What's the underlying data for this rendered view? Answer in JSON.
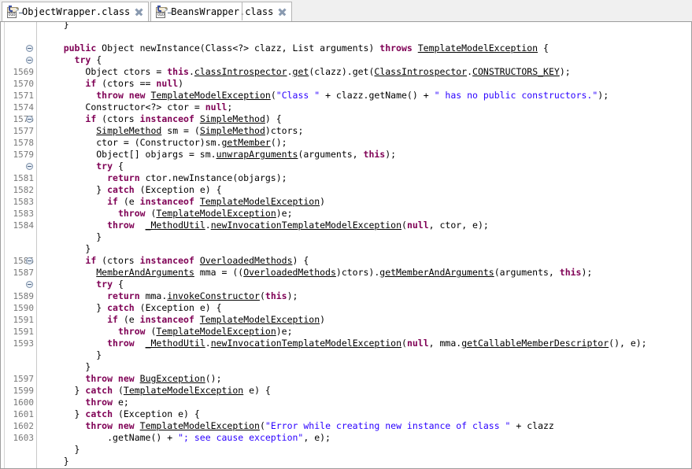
{
  "window": {
    "app": "eclipse-class-file-editor"
  },
  "tabs": [
    {
      "label": "ObjectWrapper.class",
      "icon": "class-file-icon",
      "close_icon": "close-icon",
      "active": false
    },
    {
      "label": "BeansWrapper.class",
      "icon": "class-file-icon",
      "close_icon": "close-icon",
      "active": true
    }
  ],
  "icons": {
    "class_file_bits": "010"
  },
  "colors": {
    "keyword": "#7F0055",
    "string": "#2A00FF",
    "text": "#000000",
    "line_number": "#787878",
    "gutter_border": "#C8C8C8",
    "tab_border": "#B4B4B4",
    "tab_bar_bg": "#F0F0F0"
  },
  "editor": {
    "lines": [
      {
        "num": "",
        "fold": false,
        "indent": 2,
        "tokens": [
          {
            "t": "}",
            "c": "plain"
          }
        ]
      },
      {
        "num": "",
        "fold": false,
        "indent": 0,
        "tokens": []
      },
      {
        "num": "",
        "fold": true,
        "indent": 2,
        "tokens": [
          {
            "t": "public ",
            "c": "kw"
          },
          {
            "t": "Object newInstance(Class<?> clazz, List arguments) ",
            "c": "plain"
          },
          {
            "t": "throws ",
            "c": "kw"
          },
          {
            "t": "TemplateModelException",
            "c": "plain ul"
          },
          {
            "t": " {",
            "c": "plain"
          }
        ]
      },
      {
        "num": "",
        "fold": true,
        "indent": 3,
        "tokens": [
          {
            "t": "try ",
            "c": "kw"
          },
          {
            "t": "{",
            "c": "plain"
          }
        ]
      },
      {
        "num": "1569",
        "fold": false,
        "indent": 4,
        "tokens": [
          {
            "t": "Object ctors = ",
            "c": "plain"
          },
          {
            "t": "this",
            "c": "kw"
          },
          {
            "t": ".",
            "c": "plain"
          },
          {
            "t": "classIntrospector",
            "c": "plain ul"
          },
          {
            "t": ".",
            "c": "plain"
          },
          {
            "t": "get",
            "c": "plain ul"
          },
          {
            "t": "(clazz).get(",
            "c": "plain"
          },
          {
            "t": "ClassIntrospector",
            "c": "plain ul"
          },
          {
            "t": ".",
            "c": "plain"
          },
          {
            "t": "CONSTRUCTORS_KEY",
            "c": "plain ul"
          },
          {
            "t": ");",
            "c": "plain"
          }
        ]
      },
      {
        "num": "1570",
        "fold": false,
        "indent": 4,
        "tokens": [
          {
            "t": "if ",
            "c": "kw"
          },
          {
            "t": "(ctors == ",
            "c": "plain"
          },
          {
            "t": "null",
            "c": "kw"
          },
          {
            "t": ")",
            "c": "plain"
          }
        ]
      },
      {
        "num": "1571",
        "fold": false,
        "indent": 5,
        "tokens": [
          {
            "t": "throw new ",
            "c": "kw"
          },
          {
            "t": "TemplateModelException",
            "c": "plain ul"
          },
          {
            "t": "(",
            "c": "plain"
          },
          {
            "t": "\"Class \"",
            "c": "str"
          },
          {
            "t": " + clazz.getName() + ",
            "c": "plain"
          },
          {
            "t": "\" has no public constructors.\"",
            "c": "str"
          },
          {
            "t": ");",
            "c": "plain"
          }
        ]
      },
      {
        "num": "1574",
        "fold": false,
        "indent": 4,
        "tokens": [
          {
            "t": "Constructor<?> ctor = ",
            "c": "plain"
          },
          {
            "t": "null",
            "c": "kw"
          },
          {
            "t": ";",
            "c": "plain"
          }
        ]
      },
      {
        "num": "1576",
        "fold": true,
        "indent": 4,
        "tokens": [
          {
            "t": "if ",
            "c": "kw"
          },
          {
            "t": "(ctors ",
            "c": "plain"
          },
          {
            "t": "instanceof ",
            "c": "kw"
          },
          {
            "t": "SimpleMethod",
            "c": "plain ul"
          },
          {
            "t": ") {",
            "c": "plain"
          }
        ]
      },
      {
        "num": "1577",
        "fold": false,
        "indent": 5,
        "tokens": [
          {
            "t": "SimpleMethod",
            "c": "plain ul"
          },
          {
            "t": " sm = (",
            "c": "plain"
          },
          {
            "t": "SimpleMethod",
            "c": "plain ul"
          },
          {
            "t": ")ctors;",
            "c": "plain"
          }
        ]
      },
      {
        "num": "1578",
        "fold": false,
        "indent": 5,
        "tokens": [
          {
            "t": "ctor = (Constructor)sm.",
            "c": "plain"
          },
          {
            "t": "getMember",
            "c": "plain ul"
          },
          {
            "t": "();",
            "c": "plain"
          }
        ]
      },
      {
        "num": "1579",
        "fold": false,
        "indent": 5,
        "tokens": [
          {
            "t": "Object[] objargs = sm.",
            "c": "plain"
          },
          {
            "t": "unwrapArguments",
            "c": "plain ul"
          },
          {
            "t": "(arguments, ",
            "c": "plain"
          },
          {
            "t": "this",
            "c": "kw"
          },
          {
            "t": ");",
            "c": "plain"
          }
        ]
      },
      {
        "num": "",
        "fold": true,
        "indent": 5,
        "tokens": [
          {
            "t": "try ",
            "c": "kw"
          },
          {
            "t": "{",
            "c": "plain"
          }
        ]
      },
      {
        "num": "1581",
        "fold": false,
        "indent": 6,
        "tokens": [
          {
            "t": "return ",
            "c": "kw"
          },
          {
            "t": "ctor.newInstance(objargs);",
            "c": "plain"
          }
        ]
      },
      {
        "num": "1582",
        "fold": false,
        "indent": 5,
        "tokens": [
          {
            "t": "} ",
            "c": "plain"
          },
          {
            "t": "catch ",
            "c": "kw"
          },
          {
            "t": "(Exception e) {",
            "c": "plain"
          }
        ]
      },
      {
        "num": "1583",
        "fold": false,
        "indent": 6,
        "tokens": [
          {
            "t": "if ",
            "c": "kw"
          },
          {
            "t": "(e ",
            "c": "plain"
          },
          {
            "t": "instanceof ",
            "c": "kw"
          },
          {
            "t": "TemplateModelException",
            "c": "plain ul"
          },
          {
            "t": ")",
            "c": "plain"
          }
        ]
      },
      {
        "num": "1583",
        "fold": false,
        "indent": 7,
        "tokens": [
          {
            "t": "throw ",
            "c": "kw"
          },
          {
            "t": "(",
            "c": "plain"
          },
          {
            "t": "TemplateModelException",
            "c": "plain ul"
          },
          {
            "t": ")e;",
            "c": "plain"
          }
        ]
      },
      {
        "num": "1584",
        "fold": false,
        "indent": 6,
        "tokens": [
          {
            "t": "throw ",
            "c": "kw"
          },
          {
            "t": " ",
            "c": "plain"
          },
          {
            "t": "_MethodUtil",
            "c": "plain ul"
          },
          {
            "t": ".",
            "c": "plain"
          },
          {
            "t": "newInvocationTemplateModelException",
            "c": "plain ul"
          },
          {
            "t": "(",
            "c": "plain"
          },
          {
            "t": "null",
            "c": "kw"
          },
          {
            "t": ", ctor, e);",
            "c": "plain"
          }
        ]
      },
      {
        "num": "",
        "fold": false,
        "indent": 5,
        "tokens": [
          {
            "t": "}",
            "c": "plain"
          }
        ]
      },
      {
        "num": "",
        "fold": false,
        "indent": 4,
        "tokens": [
          {
            "t": "}",
            "c": "plain"
          }
        ]
      },
      {
        "num": "1586",
        "fold": true,
        "indent": 4,
        "tokens": [
          {
            "t": "if ",
            "c": "kw"
          },
          {
            "t": "(ctors ",
            "c": "plain"
          },
          {
            "t": "instanceof ",
            "c": "kw"
          },
          {
            "t": "OverloadedMethods",
            "c": "plain ul"
          },
          {
            "t": ") {",
            "c": "plain"
          }
        ]
      },
      {
        "num": "1587",
        "fold": false,
        "indent": 5,
        "tokens": [
          {
            "t": "MemberAndArguments",
            "c": "plain ul"
          },
          {
            "t": " mma = ((",
            "c": "plain"
          },
          {
            "t": "OverloadedMethods",
            "c": "plain ul"
          },
          {
            "t": ")ctors).",
            "c": "plain"
          },
          {
            "t": "getMemberAndArguments",
            "c": "plain ul"
          },
          {
            "t": "(arguments, ",
            "c": "plain"
          },
          {
            "t": "this",
            "c": "kw"
          },
          {
            "t": ");",
            "c": "plain"
          }
        ]
      },
      {
        "num": "",
        "fold": true,
        "indent": 5,
        "tokens": [
          {
            "t": "try ",
            "c": "kw"
          },
          {
            "t": "{",
            "c": "plain"
          }
        ]
      },
      {
        "num": "1589",
        "fold": false,
        "indent": 6,
        "tokens": [
          {
            "t": "return ",
            "c": "kw"
          },
          {
            "t": "mma.",
            "c": "plain"
          },
          {
            "t": "invokeConstructor",
            "c": "plain ul"
          },
          {
            "t": "(",
            "c": "plain"
          },
          {
            "t": "this",
            "c": "kw"
          },
          {
            "t": ");",
            "c": "plain"
          }
        ]
      },
      {
        "num": "1590",
        "fold": false,
        "indent": 5,
        "tokens": [
          {
            "t": "} ",
            "c": "plain"
          },
          {
            "t": "catch ",
            "c": "kw"
          },
          {
            "t": "(Exception e) {",
            "c": "plain"
          }
        ]
      },
      {
        "num": "1591",
        "fold": false,
        "indent": 6,
        "tokens": [
          {
            "t": "if ",
            "c": "kw"
          },
          {
            "t": "(e ",
            "c": "plain"
          },
          {
            "t": "instanceof ",
            "c": "kw"
          },
          {
            "t": "TemplateModelException",
            "c": "plain ul"
          },
          {
            "t": ")",
            "c": "plain"
          }
        ]
      },
      {
        "num": "1591",
        "fold": false,
        "indent": 7,
        "tokens": [
          {
            "t": "throw ",
            "c": "kw"
          },
          {
            "t": "(",
            "c": "plain"
          },
          {
            "t": "TemplateModelException",
            "c": "plain ul"
          },
          {
            "t": ")e;",
            "c": "plain"
          }
        ]
      },
      {
        "num": "1593",
        "fold": false,
        "indent": 6,
        "tokens": [
          {
            "t": "throw ",
            "c": "kw"
          },
          {
            "t": " ",
            "c": "plain"
          },
          {
            "t": "_MethodUtil",
            "c": "plain ul"
          },
          {
            "t": ".",
            "c": "plain"
          },
          {
            "t": "newInvocationTemplateModelException",
            "c": "plain ul"
          },
          {
            "t": "(",
            "c": "plain"
          },
          {
            "t": "null",
            "c": "kw"
          },
          {
            "t": ", mma.",
            "c": "plain"
          },
          {
            "t": "getCallableMemberDescriptor",
            "c": "plain ul"
          },
          {
            "t": "(), e);",
            "c": "plain"
          }
        ]
      },
      {
        "num": "",
        "fold": false,
        "indent": 5,
        "tokens": [
          {
            "t": "}",
            "c": "plain"
          }
        ]
      },
      {
        "num": "",
        "fold": false,
        "indent": 4,
        "tokens": [
          {
            "t": "}",
            "c": "plain"
          }
        ]
      },
      {
        "num": "1597",
        "fold": false,
        "indent": 4,
        "tokens": [
          {
            "t": "throw new ",
            "c": "kw"
          },
          {
            "t": "BugException",
            "c": "plain ul"
          },
          {
            "t": "();",
            "c": "plain"
          }
        ]
      },
      {
        "num": "1599",
        "fold": false,
        "indent": 3,
        "tokens": [
          {
            "t": "} ",
            "c": "plain"
          },
          {
            "t": "catch ",
            "c": "kw"
          },
          {
            "t": "(",
            "c": "plain"
          },
          {
            "t": "TemplateModelException",
            "c": "plain ul"
          },
          {
            "t": " e) {",
            "c": "plain"
          }
        ]
      },
      {
        "num": "1600",
        "fold": false,
        "indent": 4,
        "tokens": [
          {
            "t": "throw ",
            "c": "kw"
          },
          {
            "t": "e;",
            "c": "plain"
          }
        ]
      },
      {
        "num": "1601",
        "fold": false,
        "indent": 3,
        "tokens": [
          {
            "t": "} ",
            "c": "plain"
          },
          {
            "t": "catch ",
            "c": "kw"
          },
          {
            "t": "(Exception e) {",
            "c": "plain"
          }
        ]
      },
      {
        "num": "1602",
        "fold": false,
        "indent": 4,
        "tokens": [
          {
            "t": "throw new ",
            "c": "kw"
          },
          {
            "t": "TemplateModelException",
            "c": "plain ul"
          },
          {
            "t": "(",
            "c": "plain"
          },
          {
            "t": "\"Error while creating new instance of class \"",
            "c": "str"
          },
          {
            "t": " + clazz",
            "c": "plain"
          }
        ]
      },
      {
        "num": "1603",
        "fold": false,
        "indent": 6,
        "tokens": [
          {
            "t": ".getName() + ",
            "c": "plain"
          },
          {
            "t": "\"; see cause exception\"",
            "c": "str"
          },
          {
            "t": ", e);",
            "c": "plain"
          }
        ]
      },
      {
        "num": "",
        "fold": false,
        "indent": 3,
        "tokens": [
          {
            "t": "}",
            "c": "plain"
          }
        ]
      },
      {
        "num": "",
        "fold": false,
        "indent": 2,
        "tokens": [
          {
            "t": "}",
            "c": "plain"
          }
        ]
      }
    ]
  }
}
